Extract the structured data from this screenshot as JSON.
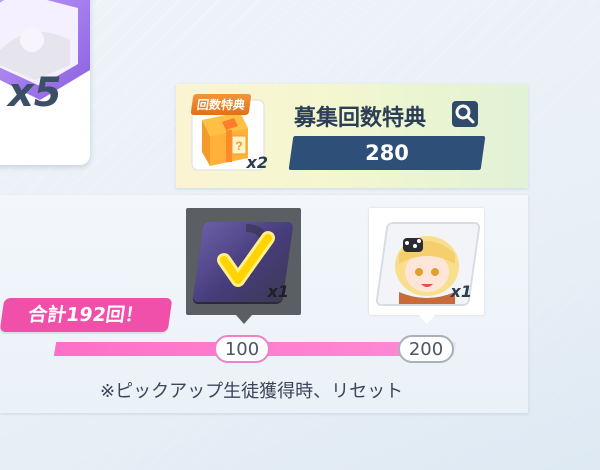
{
  "summon": {
    "multiplier_label": "x5"
  },
  "bonus": {
    "tag_label": "回数特典",
    "box_quantity": "x2",
    "title": "募集回数特典",
    "count": "280"
  },
  "rewards": [
    {
      "quantity": "x1",
      "threshold": "100",
      "state": "claimed"
    },
    {
      "quantity": "x1",
      "threshold": "200",
      "state": "next"
    }
  ],
  "total_label": "合計192回！",
  "progress": {
    "current": 192,
    "max": 200
  },
  "note": "※ピックアップ生徒獲得時、リセット",
  "colors": {
    "accent_pink": "#f04faa",
    "progress_fill": "#ff77cc",
    "counter_blue": "#2d4f78",
    "claimed_check": "#ffe01a"
  }
}
